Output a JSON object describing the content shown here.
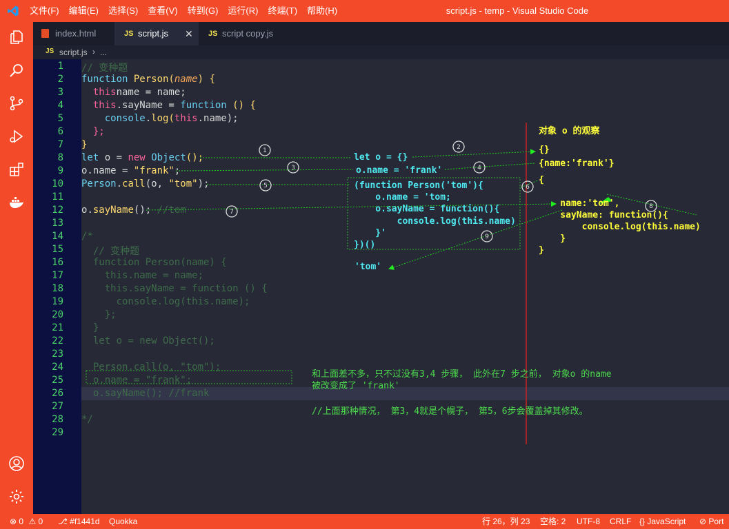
{
  "window": {
    "title": "script.js - temp - Visual Studio Code"
  },
  "menu": [
    "文件(F)",
    "编辑(E)",
    "选择(S)",
    "查看(V)",
    "转到(G)",
    "运行(R)",
    "终端(T)",
    "帮助(H)"
  ],
  "tabs": [
    {
      "label": "index.html",
      "icon": "html5-icon"
    },
    {
      "label": "script.js",
      "icon": "js-icon",
      "active": true
    },
    {
      "label": "script copy.js",
      "icon": "js-icon"
    }
  ],
  "breadcrumb": {
    "file": "script.js",
    "rest": "..."
  },
  "activity": [
    "files-icon",
    "search-icon",
    "source-control-icon",
    "run-debug-icon",
    "extensions-icon",
    "docker-icon",
    "account-icon",
    "settings-gear-icon"
  ],
  "lines": [
    "1",
    "2",
    "3",
    "4",
    "5",
    "6",
    "7",
    "8",
    "9",
    "10",
    "11",
    "12",
    "13",
    "14",
    "15",
    "16",
    "17",
    "18",
    "19",
    "20",
    "21",
    "22",
    "23",
    "24",
    "25",
    "26",
    "27",
    "28",
    "29"
  ],
  "code": {
    "l1": "// 变种题",
    "l2": {
      "a": "function ",
      "b": "Person",
      "c": "(",
      "d": "name",
      "e": ") {"
    },
    "l3": {
      "a": "  this",
      ".": ".",
      "b": "name = name;"
    },
    "l4": {
      "a": "  this",
      "b": ".sayName = ",
      "c": "function",
      "d": " () {"
    },
    "l5": {
      "a": "    console",
      "b": ".",
      "c": "log",
      "d": "(",
      "e": "this",
      "f": ".name);"
    },
    "l6": "  };",
    "l7": "}",
    "l8": {
      "a": "let",
      "b": " o = ",
      "c": "new",
      "d": " ",
      "e": "Object",
      "f": "();"
    },
    "l9": {
      "a": "o.name = ",
      "b": "\"frank\"",
      "c": ";"
    },
    "l10": {
      "a": "Person",
      "b": ".",
      "c": "call",
      "d": "(o, ",
      "e": "\"tom\"",
      "f": ");"
    },
    "l12": {
      "a": "o",
      "b": ".",
      "c": "sayName",
      "d": "(); ",
      "e": "//tom"
    },
    "l14": "/*",
    "l15": "  // 变种题",
    "l16": "  function Person(name) {",
    "l17": "    this.name = name;",
    "l18": "    this.sayName = function () {",
    "l19": "      console.log(this.name);",
    "l20": "    };",
    "l21": "  }",
    "l22": "  let o = new Object();",
    "l24": "  Person.call(o, \"tom\");",
    "l25": "  o.name = \"frank\";",
    "l26": "  o.sayName(); //frank",
    "l28": "*/"
  },
  "annotations": {
    "obs_title": "对象 o 的观察",
    "mid1": "let o = {}",
    "mid2": "o.name = 'frank'",
    "mid3": "(function Person('tom'){\n    o.name = 'tom;\n    o.sayName = function(){\n        console.log(this.name)\n    }'\n})()",
    "mid_result": "'tom'",
    "obj1": "{}",
    "obj2": "{name:'frank'}",
    "obj3": "{\n\n    name:'tom',\n    sayName: function(){\n        console.log(this.name)\n    }\n}",
    "note1": "和上面差不多，只不过没有3,4 步骤， 此外在7 步之前， 对象o 的name\n被改变成了 'frank'",
    "note2": "//上面那种情况， 第3，4就是个幌子， 第5，6步会覆盖掉其修改。",
    "steps": [
      "1",
      "2",
      "3",
      "4",
      "5",
      "6",
      "7",
      "8",
      "9"
    ]
  },
  "status": {
    "errors": "0",
    "warnings": "0",
    "commit": "#f1441d",
    "quokka": "Quokka",
    "position": "行 26，列 23",
    "spaces": "空格: 2",
    "encoding": "UTF-8",
    "eol": "CRLF",
    "language": "JavaScript",
    "port": "Port"
  }
}
